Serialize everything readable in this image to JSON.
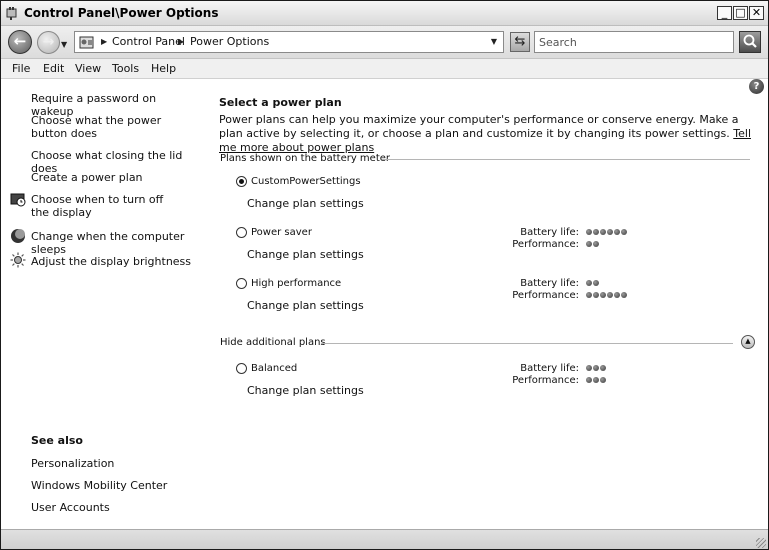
{
  "window": {
    "title": "Control Panel\\Power Options",
    "minimize_label": "_",
    "maximize_label": "□",
    "close_label": "✕"
  },
  "address_bar": {
    "back_label": "←",
    "forward_label": "→",
    "breadcrumb": [
      "Control Panel",
      "Power Options"
    ],
    "search_placeholder": "Search"
  },
  "menu": [
    "File",
    "Edit",
    "View",
    "Tools",
    "Help"
  ],
  "sidebar": {
    "tasks": [
      {
        "label": "Require a password on wakeup",
        "icon": null
      },
      {
        "label": "Choose what the power button does",
        "icon": null
      },
      {
        "label": "Choose what closing the lid does",
        "icon": null
      },
      {
        "label": "Create a power plan",
        "icon": null
      },
      {
        "label": "Choose when to turn off the display",
        "icon": "monitor-clock-icon"
      },
      {
        "label": "Change when the computer sleeps",
        "icon": "moon-icon"
      },
      {
        "label": "Adjust the display brightness",
        "icon": "sun-icon"
      }
    ],
    "see_also_title": "See also",
    "see_also": [
      "Personalization",
      "Windows Mobility Center",
      "User Accounts"
    ]
  },
  "main": {
    "heading": "Select a power plan",
    "intro": "Power plans can help you maximize your computer's performance or conserve energy. Make a plan active by selecting it, or choose a plan and customize it by changing its power settings.",
    "learn_more": "Tell me more about power plans",
    "battery_group_label": "Plans shown on the battery meter",
    "additional_group_label": "Hide additional plans",
    "change_settings_label": "Change plan settings",
    "battery_life_label": "Battery life:",
    "performance_label": "Performance:",
    "plans": [
      {
        "name": "CustomPowerSettings",
        "selected": true,
        "battery_life": null,
        "performance": null
      },
      {
        "name": "Power saver",
        "selected": false,
        "battery_life": 6,
        "performance": 2
      },
      {
        "name": "High performance",
        "selected": false,
        "battery_life": 2,
        "performance": 6
      }
    ],
    "additional_plans": [
      {
        "name": "Balanced",
        "selected": false,
        "battery_life": 3,
        "performance": 3
      }
    ]
  },
  "help_label": "?"
}
